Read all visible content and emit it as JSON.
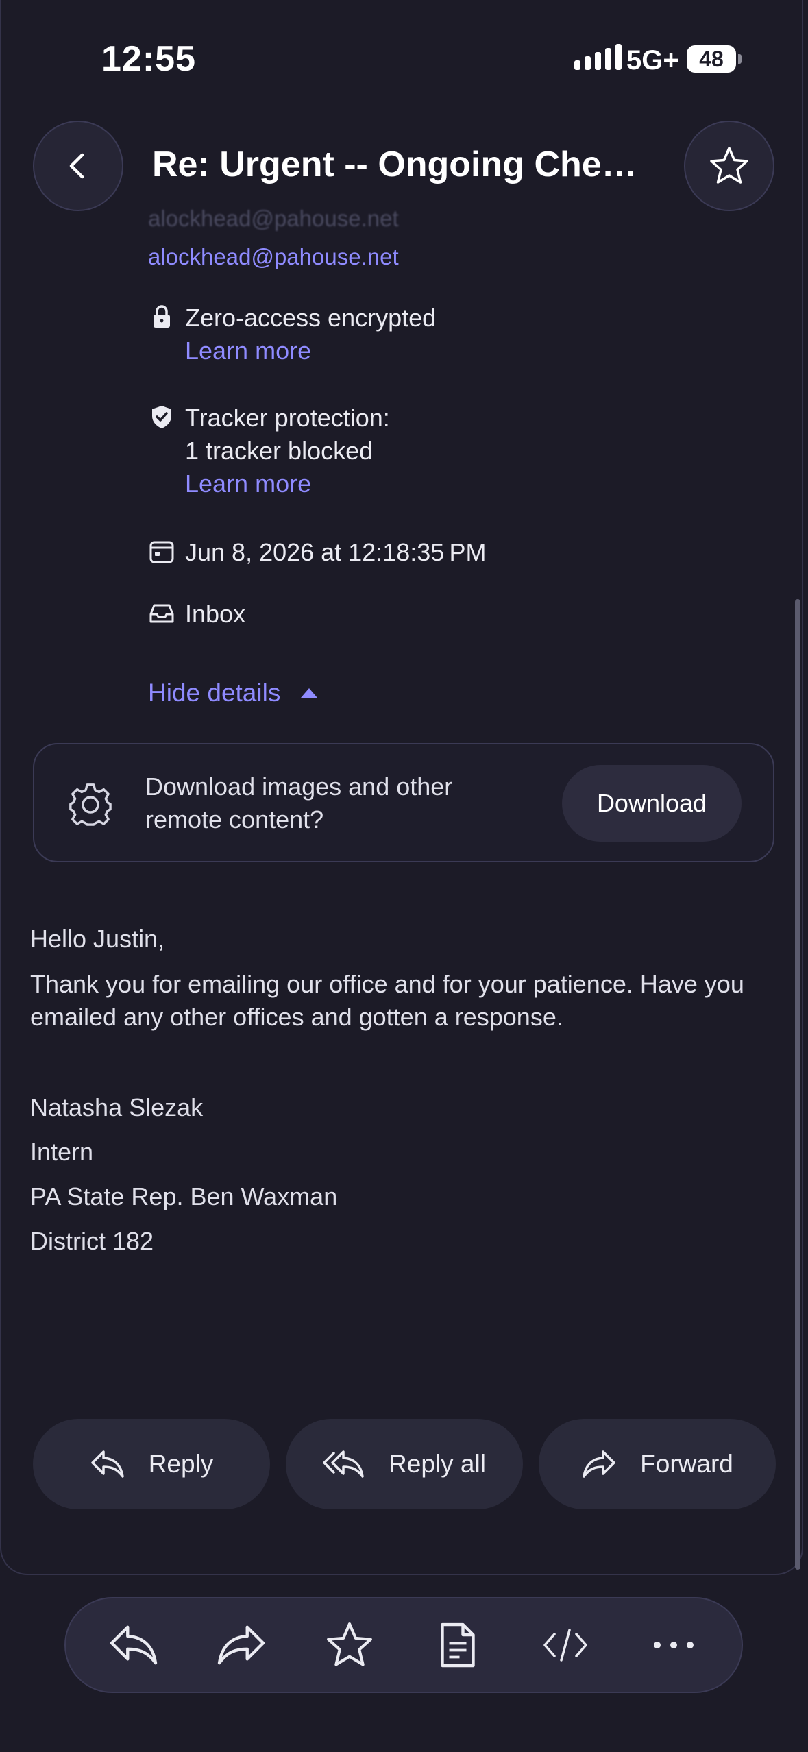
{
  "status_bar": {
    "time": "12:55",
    "network": "5G+",
    "battery": "48"
  },
  "header": {
    "subject": "Re: Urgent -- Ongoing Chemi..."
  },
  "recipients": {
    "faded": [
      "alockhead@pahouse.net"
    ],
    "visible": "alockhead@pahouse.net"
  },
  "details": {
    "encryption": {
      "label": "Zero-access encrypted",
      "link": "Learn more"
    },
    "tracker": {
      "line1": "Tracker protection:",
      "line2": "1 tracker blocked",
      "link": "Learn more"
    },
    "date": "Jun 8, 2026 at 12:18:35 PM",
    "folder": "Inbox",
    "hide_details": "Hide details"
  },
  "remote_content": {
    "message": "Download images and other remote content?",
    "button": "Download"
  },
  "body": {
    "greeting": "Hello Justin,",
    "paragraph": "Thank you for emailing our office and for your patience. Have you emailed any other offices and gotten a response.",
    "signature": [
      "Natasha Slezak",
      "Intern",
      "PA State Rep. Ben Waxman",
      "District 182"
    ]
  },
  "actions": {
    "reply": "Reply",
    "reply_all": "Reply all",
    "forward": "Forward"
  },
  "toolbar": [
    "reply-icon",
    "forward-icon",
    "star-icon",
    "document-icon",
    "code-icon",
    "more-icon"
  ],
  "colors": {
    "background": "#1c1b27",
    "accent": "#8f8bff",
    "button": "#2a2a3a"
  }
}
